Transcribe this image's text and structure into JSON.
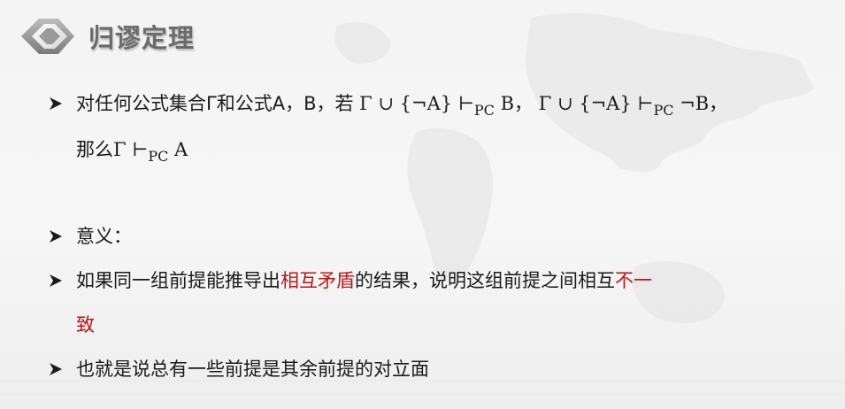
{
  "slide": {
    "title": "归谬定理"
  },
  "bullets": {
    "theorem": {
      "line1_text": "对任何公式集合Γ和公式A，B，若",
      "premise1": " Γ ∪ {¬A} ⊢",
      "sub1": "PC",
      "premise1_end": " B，",
      "premise2": " Γ ∪ {¬A} ⊢",
      "sub2": "PC",
      "premise2_end": " ¬B，",
      "line2_text": "那么",
      "conclusion": "Γ ⊢",
      "sub3": "PC",
      "conclusion_end": " A"
    },
    "meaning_label": "意义：",
    "meaning": {
      "part1": "如果同一组前提能推导出",
      "highlight1": "相互矛盾",
      "part2": "的结果，说明这组前提之间相互",
      "highlight2": "不一",
      "highlight2_cont": "致"
    },
    "corollary": "也就是说总有一些前提是其余前提的对立面"
  },
  "colors": {
    "highlight": "#c0141b",
    "title": "#6b6b6b"
  },
  "icons": {
    "title_logo": "diamond-logo-icon",
    "bullet": "arrow-bullet-icon"
  }
}
